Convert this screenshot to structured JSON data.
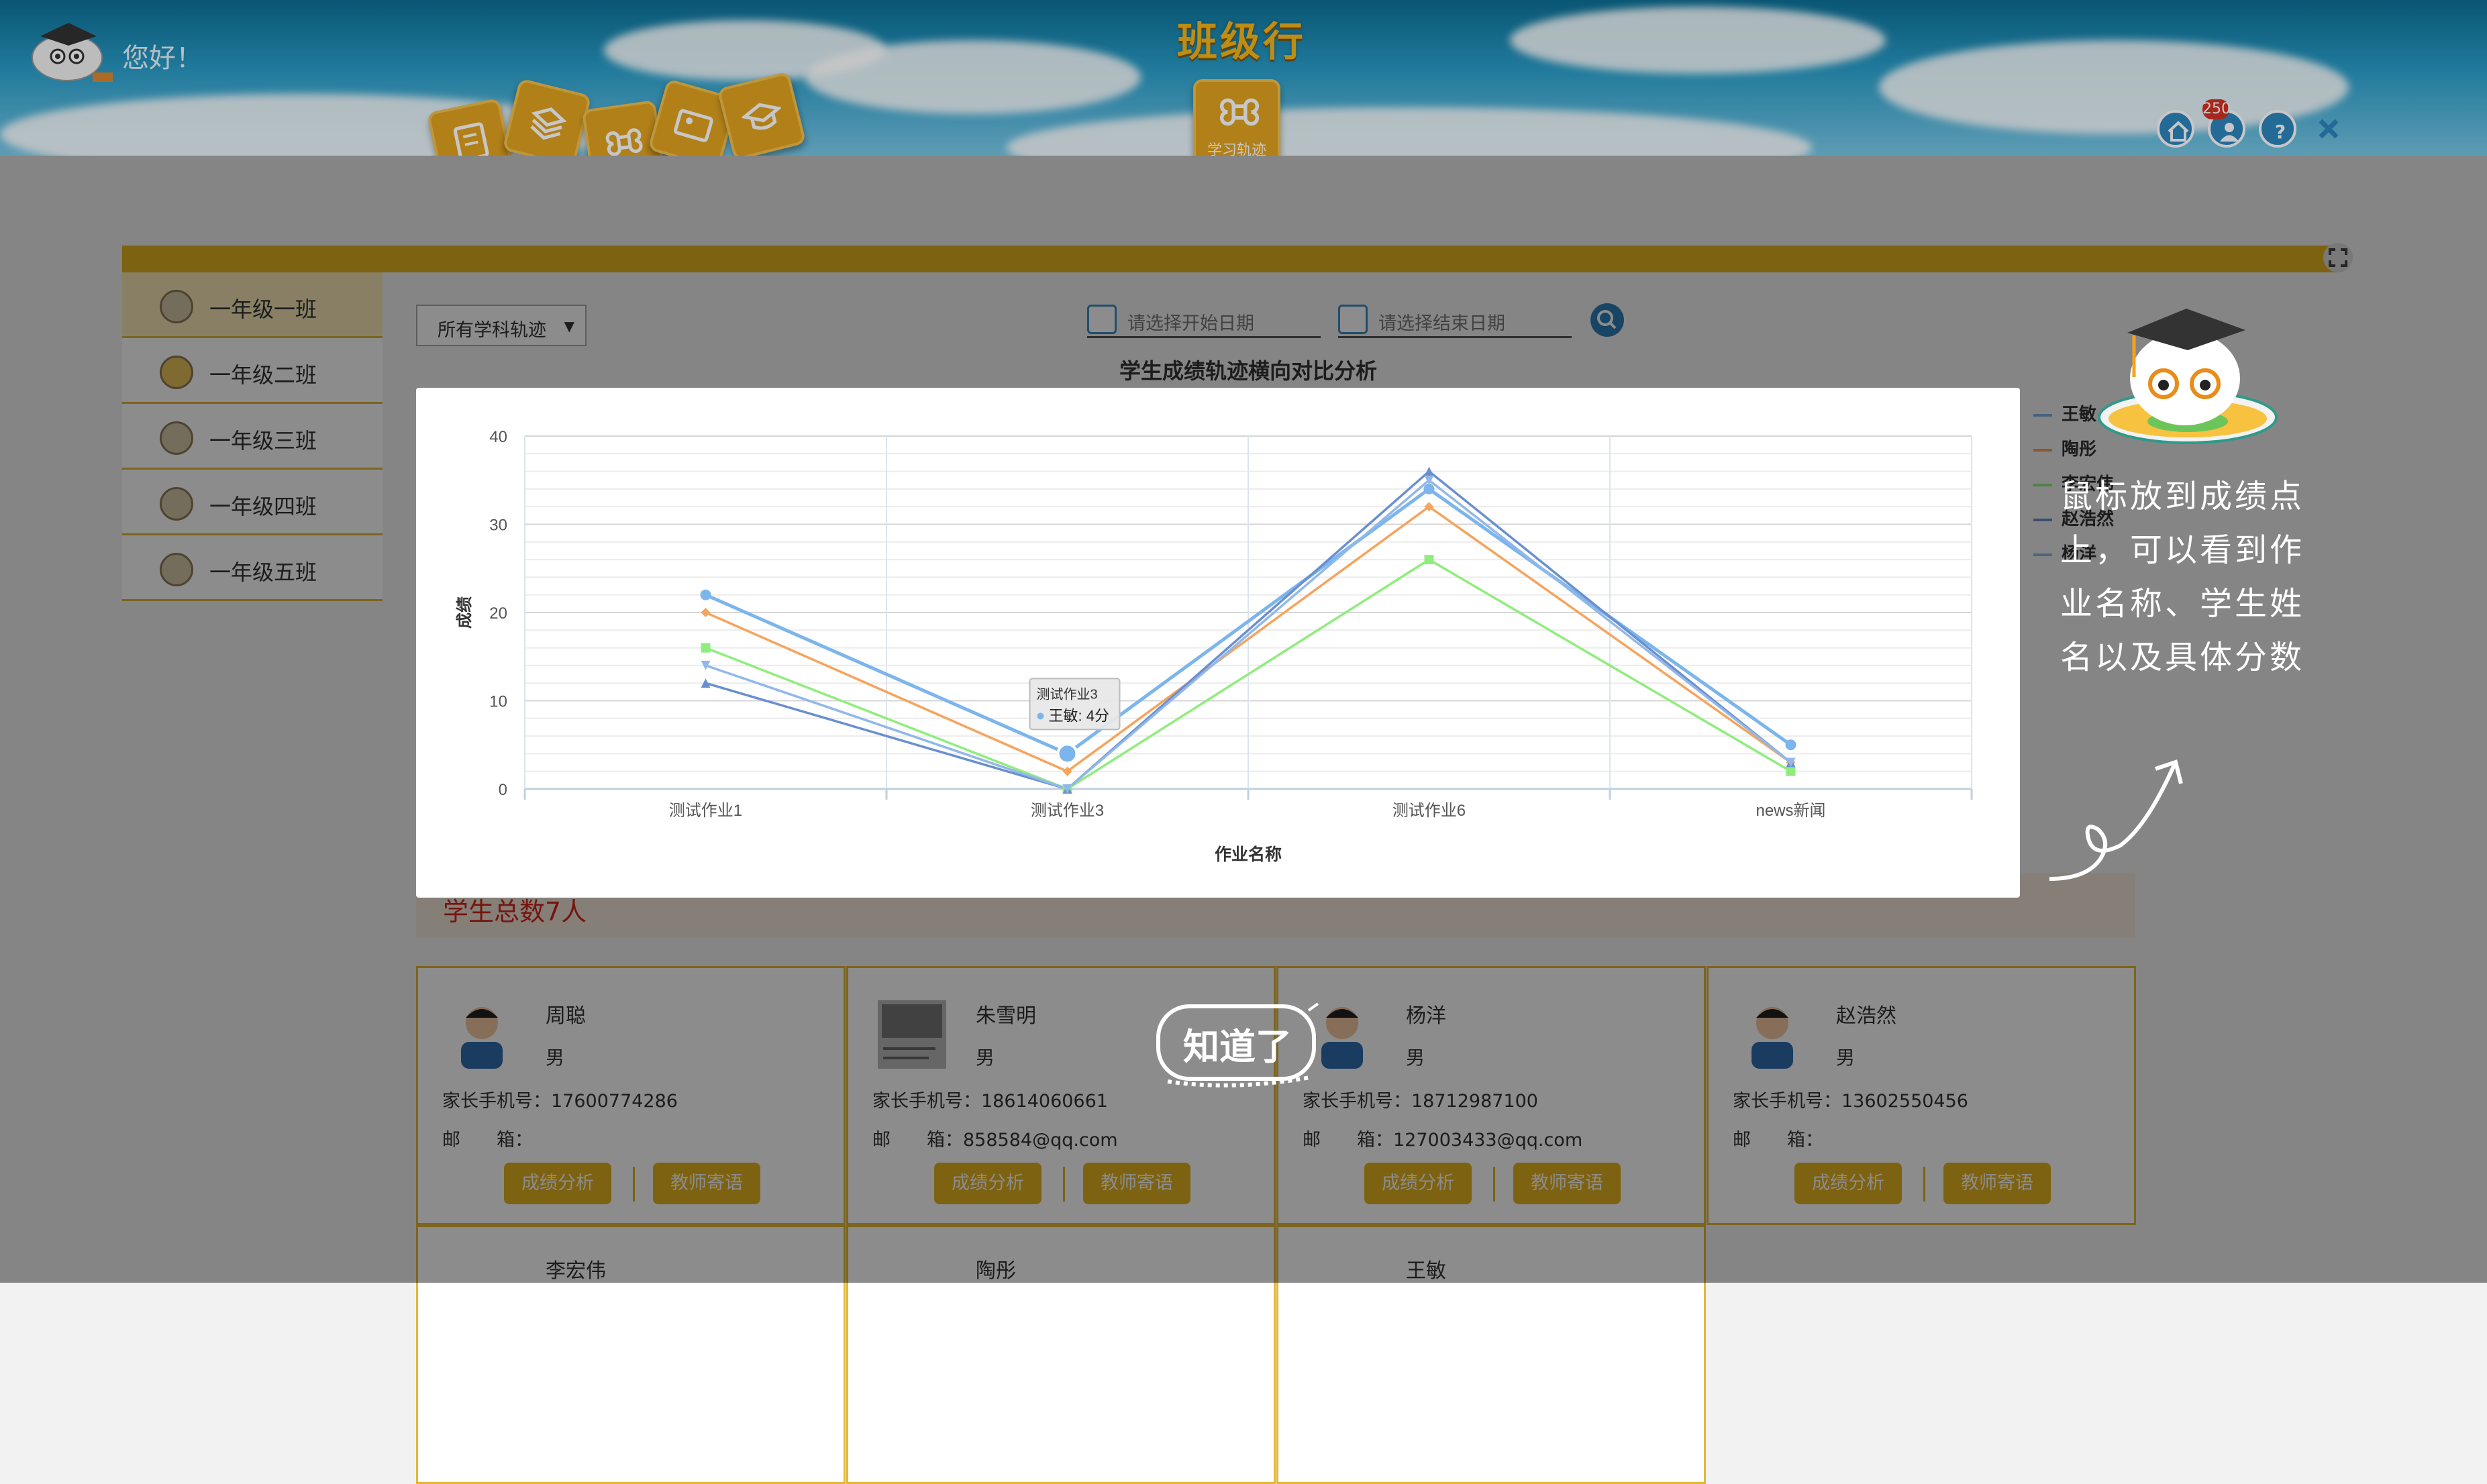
{
  "header": {
    "greeting": "您好！",
    "app_title": "班级行",
    "active_tile_label": "学习轨迹",
    "notification_count": "250"
  },
  "sidebar": {
    "classes": [
      {
        "label": "一年级一班"
      },
      {
        "label": "一年级二班"
      },
      {
        "label": "一年级三班"
      },
      {
        "label": "一年级四班"
      },
      {
        "label": "一年级五班"
      }
    ]
  },
  "filters": {
    "subject_value": "所有学科轨迹",
    "start_date_placeholder": "请选择开始日期",
    "end_date_placeholder": "请选择结束日期"
  },
  "main": {
    "chart_title": "学生成绩轨迹横向对比分析",
    "background_legend": [
      "王敏",
      "陶彤",
      "李宏伟",
      "赵浩然",
      "杨洋"
    ],
    "total_students": "学生总数7人"
  },
  "students": [
    {
      "name": "周聪",
      "gender": "男",
      "phone": "家长手机号：17600774286",
      "email": "邮　　箱："
    },
    {
      "name": "朱雪明",
      "gender": "男",
      "phone": "家长手机号：18614060661",
      "email": "邮　　箱：858584@qq.com"
    },
    {
      "name": "杨洋",
      "gender": "男",
      "phone": "家长手机号：18712987100",
      "email": "邮　　箱：127003433@qq.com"
    },
    {
      "name": "赵浩然",
      "gender": "男",
      "phone": "家长手机号：13602550456",
      "email": "邮　　箱："
    }
  ],
  "students_partial": [
    {
      "name": "李宏伟"
    },
    {
      "name": "陶彤"
    },
    {
      "name": "王敏"
    }
  ],
  "card_buttons": {
    "analysis": "成绩分析",
    "message": "教师寄语"
  },
  "tooltip": {
    "title": "测试作业3",
    "value": "王敏: 4分"
  },
  "guide": {
    "text": "鼠标放到成绩点上，可以看到作业名称、学生姓名以及具体分数",
    "got_it": "知道了"
  },
  "colors": {
    "accent": "#e4b31f",
    "header_blue": "#1f86b4"
  },
  "chart_data": {
    "type": "line",
    "title": "",
    "xlabel": "作业名称",
    "ylabel": "成绩",
    "categories": [
      "测试作业1",
      "测试作业3",
      "测试作业6",
      "news新闻"
    ],
    "ylim": [
      0,
      40
    ],
    "yticks": [
      0,
      10,
      20,
      30,
      40
    ],
    "series": [
      {
        "color": "#7cb5ec",
        "marker": "circle",
        "values": [
          22,
          4,
          34,
          5
        ]
      },
      {
        "color": "#f7a35c",
        "marker": "diamond",
        "values": [
          20,
          2,
          32,
          3
        ]
      },
      {
        "color": "#90ed7d",
        "marker": "square",
        "values": [
          16,
          0,
          26,
          2
        ]
      },
      {
        "color": "#6a8fd0",
        "marker": "triangle",
        "values": [
          12,
          0,
          36,
          3
        ]
      },
      {
        "color": "#91b8e8",
        "marker": "triangle-down",
        "values": [
          14,
          0,
          35,
          3
        ]
      }
    ],
    "legend": "right",
    "grid": true
  }
}
